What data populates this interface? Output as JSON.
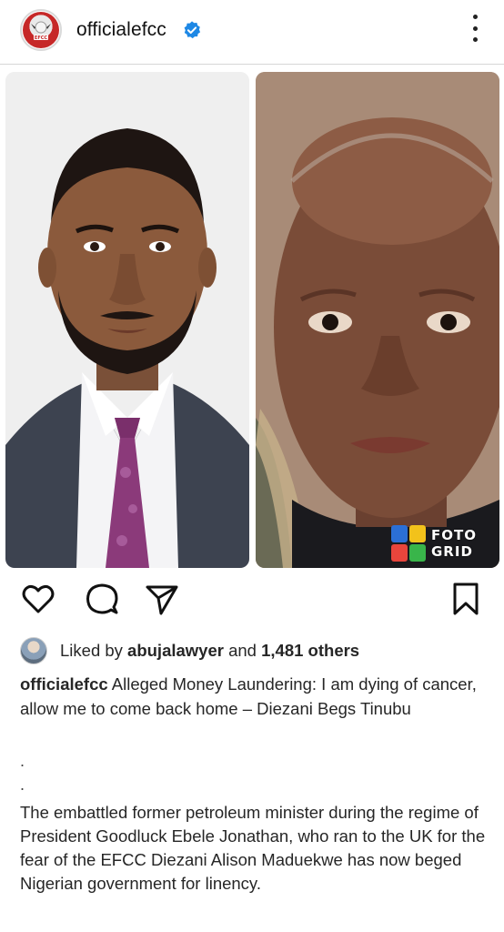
{
  "post": {
    "username": "officialefcc",
    "avatar_text": "EFCC",
    "verified": true,
    "photo_watermark": {
      "line1": "FOTO",
      "line2": "GRID"
    }
  },
  "engagement": {
    "liked_prefix": "Liked by",
    "liked_user": "abujalawyer",
    "liked_and": "and",
    "liked_others": "1,481 others"
  },
  "caption": {
    "handle": "officialefcc",
    "headline": "Alleged Money Laundering: I am dying of cancer, allow me to come back home – Diezani Begs Tinubu",
    "dot1": ".",
    "dot2": ".",
    "body": "The embattled former petroleum minister during the regime of President Goodluck Ebele Jonathan, who ran to the UK for the fear of the EFCC Diezani Alison Maduekwe has now beged Nigerian government for linency."
  },
  "icons": {
    "like": "heart-icon",
    "comment": "comment-icon",
    "share": "send-icon",
    "save": "bookmark-icon",
    "more": "more-vertical-icon",
    "verified": "verified-badge-icon"
  },
  "colors": {
    "verified_blue": "#1e88e5",
    "text": "#262626",
    "efcc_red": "#c62828"
  }
}
